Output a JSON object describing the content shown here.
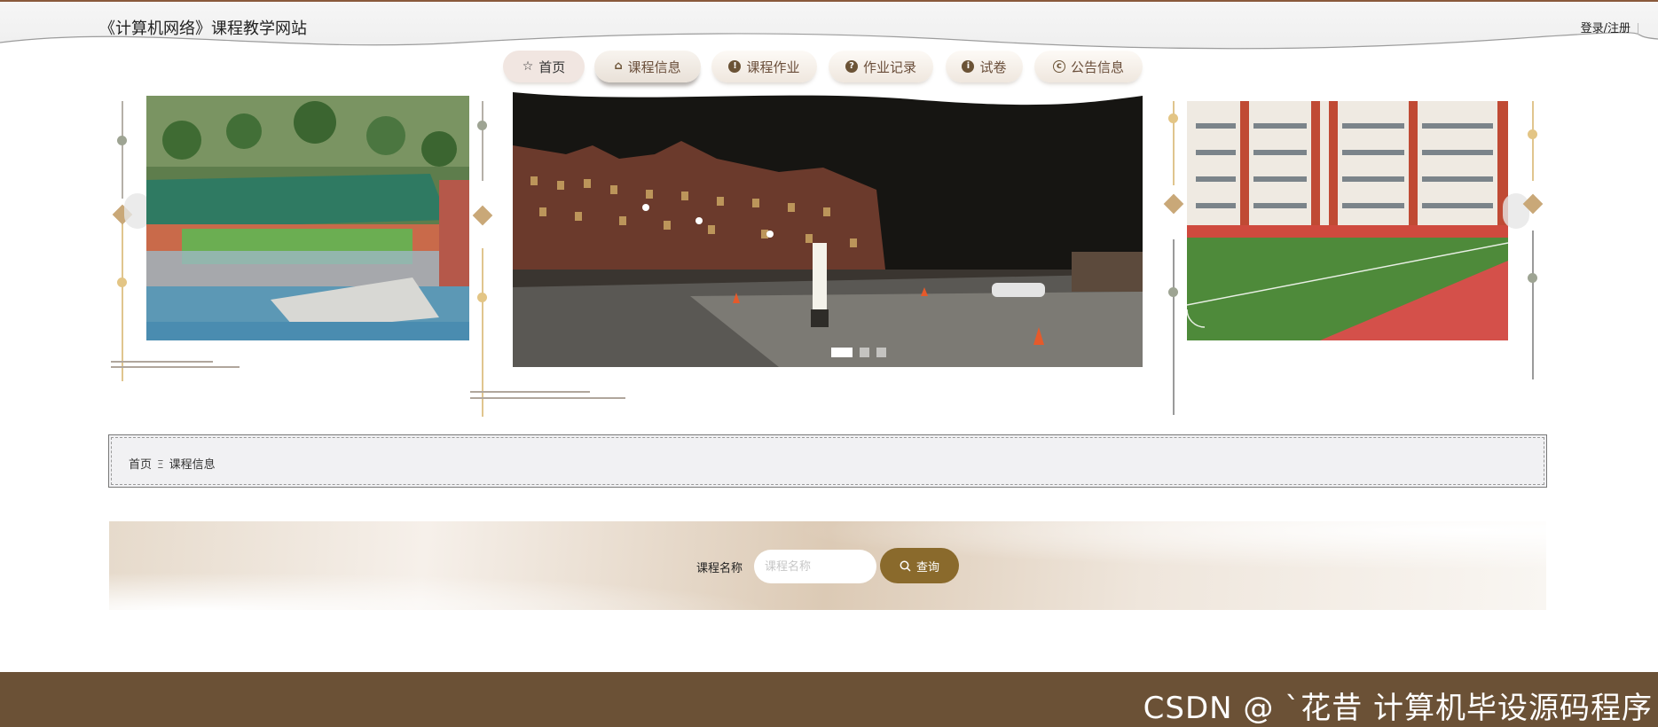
{
  "header": {
    "site_title": "《计算机网络》课程教学网站",
    "login_link": "登录/注册"
  },
  "nav": {
    "items": [
      {
        "label": "首页",
        "icon": "star-icon"
      },
      {
        "label": "课程信息",
        "icon": "bag-icon",
        "active": true
      },
      {
        "label": "课程作业",
        "icon": "exclamation-icon"
      },
      {
        "label": "作业记录",
        "icon": "question-icon"
      },
      {
        "label": "试卷",
        "icon": "info-icon"
      },
      {
        "label": "公告信息",
        "icon": "copyright-icon"
      }
    ]
  },
  "carousel": {
    "slide_count": 3,
    "active_index": 0
  },
  "breadcrumb": {
    "home": "首页",
    "separator": "Ξ",
    "current": "课程信息"
  },
  "search": {
    "label": "课程名称",
    "placeholder": "课程名称",
    "button_label": "查询"
  },
  "footer": {
    "watermark": "CSDN @ ˋ花昔  计算机毕设源码程序"
  },
  "colors": {
    "accent": "#8a6a2c",
    "footer": "#6b5136",
    "nav_text": "#6a4e3a",
    "decor_gold": "#c9a878"
  }
}
